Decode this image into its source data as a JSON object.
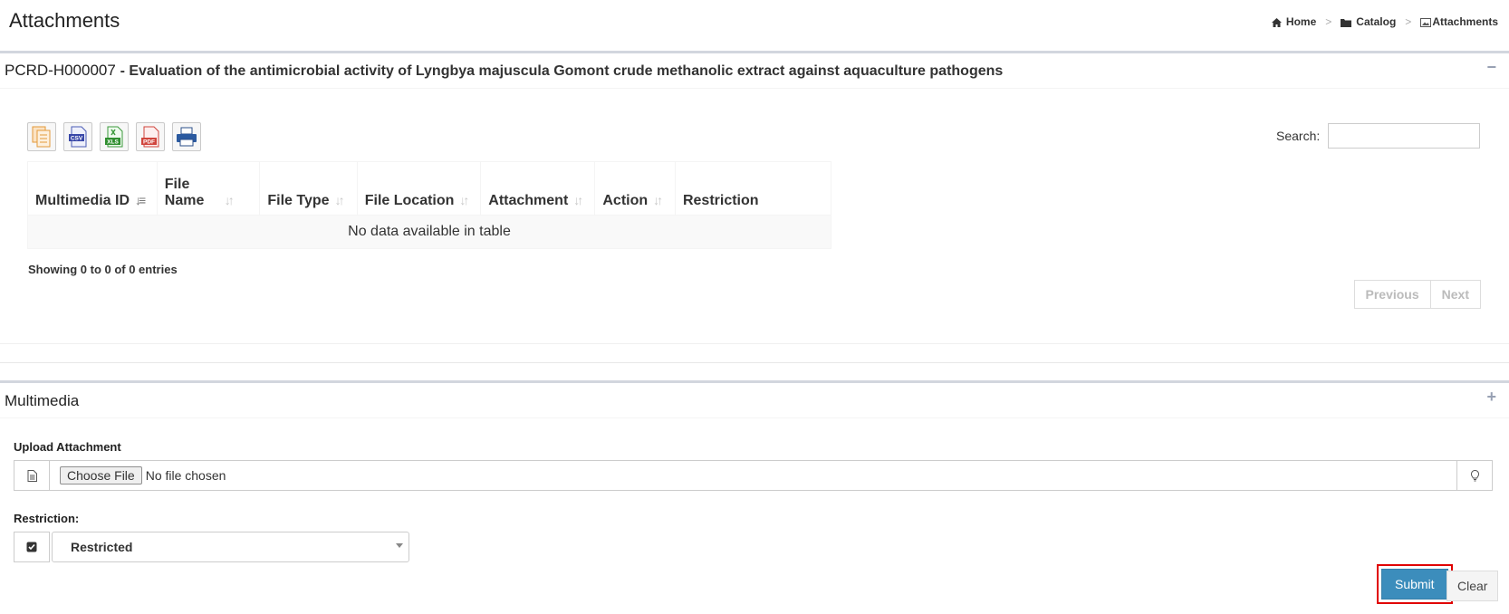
{
  "page": {
    "title": "Attachments"
  },
  "breadcrumb": {
    "home": "Home",
    "sep1": ">",
    "catalog": "Catalog",
    "sep2": ">",
    "current": "Attachments"
  },
  "project": {
    "code": "PCRD-H000007",
    "title": "- Evaluation of the antimicrobial activity of Lyngbya majuscula Gomont crude methanolic extract against aquaculture pathogens",
    "collapse_symbol": "−"
  },
  "export_buttons": [
    "copy-icon",
    "csv-icon",
    "xls-icon",
    "pdf-icon",
    "print-icon"
  ],
  "search": {
    "label": "Search:",
    "value": ""
  },
  "table": {
    "columns": [
      "Multimedia ID",
      "File Name",
      "File Type",
      "File Location",
      "Attachment",
      "Action",
      "Restriction"
    ],
    "empty_text": "No data available in table",
    "info": "Showing 0 to 0 of 0 entries"
  },
  "pagination": {
    "previous": "Previous",
    "next": "Next"
  },
  "multimedia": {
    "title": "Multimedia",
    "expand_symbol": "+",
    "upload_label": "Upload Attachment",
    "choose_file": "Choose File",
    "no_file": "No file chosen",
    "restriction_label": "Restriction:",
    "restriction_value": "Restricted"
  },
  "actions": {
    "submit": "Submit",
    "clear": "Clear"
  },
  "colors": {
    "primary": "#3c8dbc",
    "highlight": "#e00000"
  }
}
